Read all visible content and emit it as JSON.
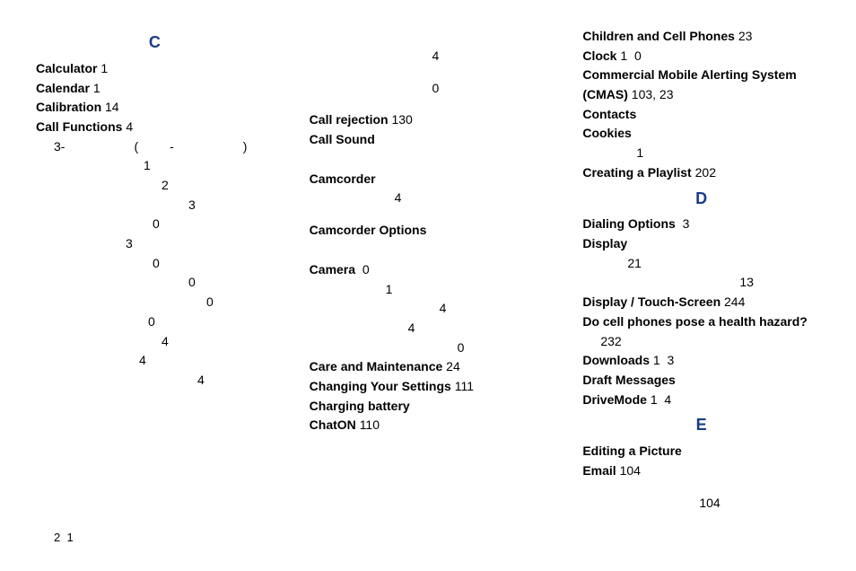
{
  "letter": {
    "c": "C",
    "d": "D",
    "e": "E"
  },
  "col1": {
    "calc_t": "Calculator",
    "calc_n": "1",
    "cal_t": "Calendar",
    "cal_n": "1",
    "calib_t": "Calibration",
    "calib_n": "14",
    "cf_t": "Call Functions",
    "cf_n": "4",
    "cf_sub_3way": "3-",
    "cf_sub_3way_p": "(",
    "cf_sub_3way_dash": "-",
    "cf_sub_3way_cp": ")",
    "s1": "1",
    "s2": "2",
    "s3": "3",
    "s4": "0",
    "s5": "3",
    "s6": "0",
    "s7": "0",
    "s8": "0",
    "s9": "0",
    "s10": "4",
    "s11": "4",
    "s12": "4"
  },
  "col2": {
    "n1": "4",
    "n2": "0",
    "crej_t": "Call rejection",
    "crej_n": "130",
    "csound_t": "Call Sound",
    "cam_t": "Camcorder",
    "cam_n": "4",
    "camop_t": "Camcorder Options",
    "camera_t": "Camera",
    "camera_n": "0",
    "cn1": "1",
    "cn2": "4",
    "cn3": "4",
    "cn4": "0",
    "care_t": "Care and Maintenance",
    "care_n": "24",
    "chg_t": "Changing Your Settings",
    "chg_n": "111",
    "charge_t": "Charging battery",
    "chaton_t": "ChatON",
    "chaton_n": "110"
  },
  "col3": {
    "child_t": "Children and Cell Phones",
    "child_n": "23",
    "clock_t": "Clock",
    "clock_n1": "1",
    "clock_n2": "0",
    "cmas_t": "Commercial Mobile Alerting System (CMAS)",
    "cmas_n1": "103",
    "cmas_comma": ",",
    "cmas_n2": "23",
    "contacts_t": "Contacts",
    "cookies_t": "Cookies",
    "cookies_n": "1",
    "playlist_t": "Creating a Playlist",
    "playlist_n": "202",
    "dial_t": "Dialing Options",
    "dial_n": "3",
    "disp_t": "Display",
    "disp_n1": "21",
    "disp_n2": "13",
    "dts_t": "Display / Touch-Screen",
    "dts_n": "244",
    "health_t": "Do cell phones pose a health hazard?",
    "health_n": "232",
    "dl_t": "Downloads",
    "dl_n1": "1",
    "dl_n2": "3",
    "draft_t": "Draft Messages",
    "drive_t": "DriveMode",
    "drive_n1": "1",
    "drive_n2": "4",
    "edit_t": "Editing a Picture",
    "email_t": "Email",
    "email_n": "104",
    "email_n2": "104"
  },
  "footer": {
    "a": "2",
    "b": "1"
  }
}
